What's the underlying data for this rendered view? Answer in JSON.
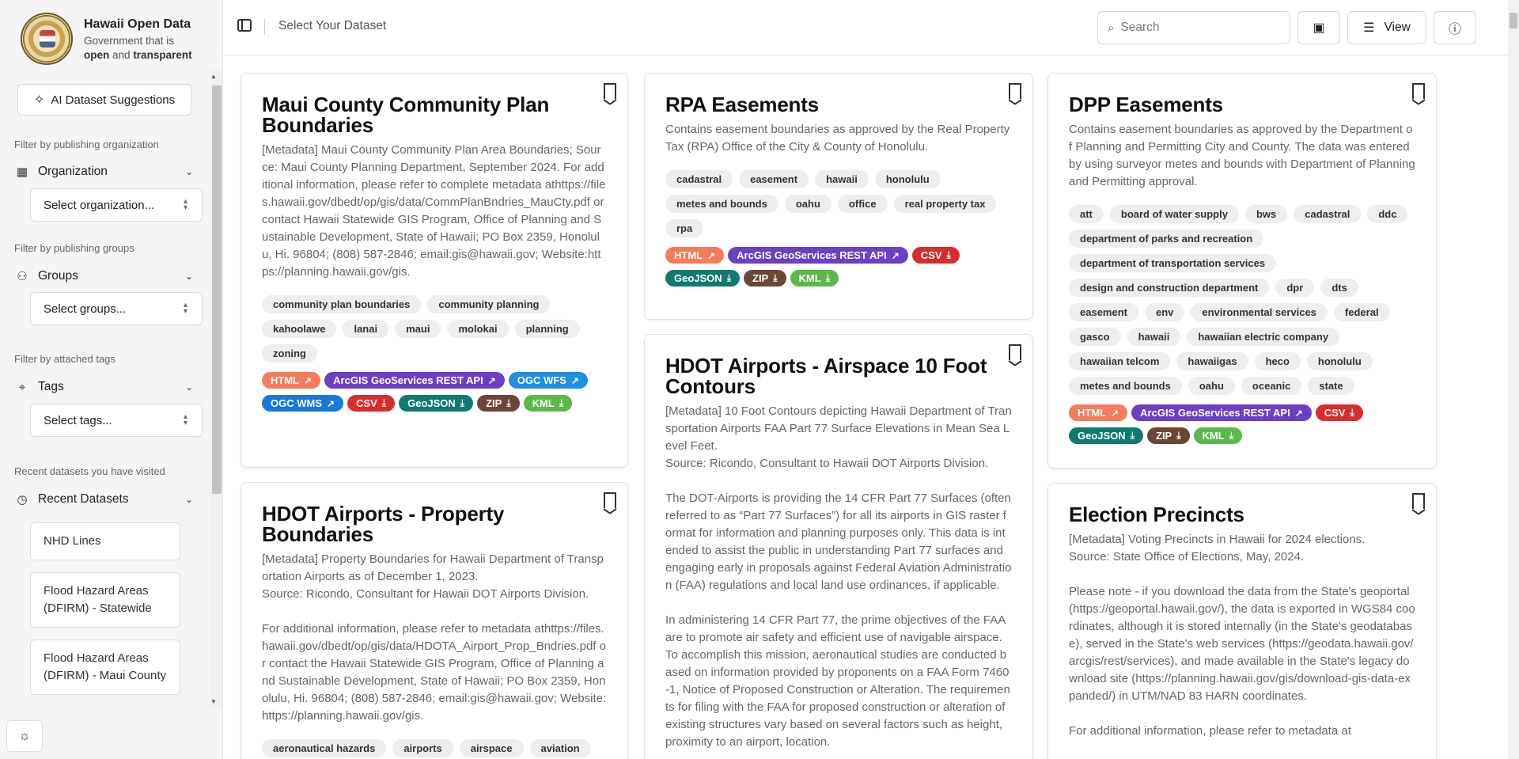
{
  "brand": {
    "title": "Hawaii Open Data",
    "subtitle_pre": "Government that is",
    "subtitle_open": "open",
    "subtitle_and": "and",
    "subtitle_transparent": "transparent"
  },
  "sidebar": {
    "ai_button": "AI Dataset Suggestions",
    "org": {
      "hint": "Filter by publishing organization",
      "label": "Organization",
      "placeholder": "Select organization..."
    },
    "groups": {
      "hint": "Filter by publishing groups",
      "label": "Groups",
      "placeholder": "Select groups..."
    },
    "tags": {
      "hint": "Filter by attached tags",
      "label": "Tags",
      "placeholder": "Select tags..."
    },
    "recent": {
      "hint": "Recent datasets you have visited",
      "label": "Recent Datasets",
      "items": [
        "NHD Lines",
        "Flood Hazard Areas (DFIRM) - Statewide",
        "Flood Hazard Areas (DFIRM) - Maui County"
      ]
    }
  },
  "header": {
    "breadcrumb": "Select Your Dataset",
    "search_placeholder": "Search",
    "view_label": "View"
  },
  "icons": {
    "seal": "state-seal",
    "ai": "sparkle-brain-icon",
    "org": "building-icon",
    "groups": "users-icon",
    "tags": "tags-icon",
    "recent": "clock-icon",
    "theme": "sun-icon",
    "search": "search-icon",
    "calendar": "calendar-icon",
    "view": "sliders-icon",
    "help": "help-circle-icon",
    "bookmark": "bookmark-icon"
  },
  "format_colors": {
    "HTML": "#f47c5a",
    "ArcGIS GeoServices REST API": "#6c3fc4",
    "OGC WFS": "#1f8fe0",
    "OGC WMS": "#1a78d8",
    "CSV": "#d92d2d",
    "GeoJSON": "#0f7a70",
    "ZIP": "#6b4535",
    "KML": "#5cb84a"
  },
  "cards": [
    {
      "title": "Maui County Community Plan Boundaries",
      "description": "[Metadata] Maui County Community Plan Area Boundaries; Source: Maui County Planning Department, September 2024. For additional information, please refer to complete metadata athttps://files.hawaii.gov/dbedt/op/gis/data/CommPlanBndries_MauCty.pdf or contact Hawaii Statewide GIS Program, Office of Planning and Sustainable Development, State of Hawaii; PO Box 2359, Honolulu, Hi. 96804; (808) 587-2846; email:gis@hawaii.gov; Website:https://planning.hawaii.gov/gis.",
      "tags": [
        "community plan boundaries",
        "community planning",
        "kahoolawe",
        "lanai",
        "maui",
        "molokai",
        "planning",
        "zoning"
      ],
      "formats": [
        {
          "label": "HTML",
          "icon": "external-link-icon"
        },
        {
          "label": "ArcGIS GeoServices REST API",
          "icon": "external-link-icon"
        },
        {
          "label": "OGC WFS",
          "icon": "external-link-icon"
        },
        {
          "label": "OGC WMS",
          "icon": "external-link-icon"
        },
        {
          "label": "CSV",
          "icon": "download-icon"
        },
        {
          "label": "GeoJSON",
          "icon": "download-icon"
        },
        {
          "label": "ZIP",
          "icon": "download-icon"
        },
        {
          "label": "KML",
          "icon": "download-icon"
        }
      ]
    },
    {
      "title": "HDOT Airports - Property Boundaries",
      "description": "[Metadata] Property Boundaries for Hawaii Department of Transportation Airports as of December 1, 2023.\nSource: Ricondo, Consultant for Hawaii DOT Airports Division.\n\nFor additional information, please refer to metadata athttps://files.hawaii.gov/dbedt/op/gis/data/HDOTA_Airport_Prop_Bndries.pdf or contact the Hawaii Statewide GIS Program, Office of Planning and Sustainable Development, State of Hawaii; PO Box 2359, Honolulu, Hi. 96804; (808) 587-2846; email:gis@hawaii.gov; Website:https://planning.hawaii.gov/gis.",
      "tags": [
        "aeronautical hazards",
        "airports",
        "airspace",
        "aviation"
      ],
      "formats": []
    },
    {
      "title": "RPA Easements",
      "description": "Contains easement boundaries as approved by the Real Property Tax (RPA) Office of the City & County of Honolulu.",
      "tags": [
        "cadastral",
        "easement",
        "hawaii",
        "honolulu",
        "metes and bounds",
        "oahu",
        "office",
        "real property tax",
        "rpa"
      ],
      "formats": [
        {
          "label": "HTML",
          "icon": "external-link-icon"
        },
        {
          "label": "ArcGIS GeoServices REST API",
          "icon": "external-link-icon"
        },
        {
          "label": "CSV",
          "icon": "download-icon"
        },
        {
          "label": "GeoJSON",
          "icon": "download-icon"
        },
        {
          "label": "ZIP",
          "icon": "download-icon"
        },
        {
          "label": "KML",
          "icon": "download-icon"
        }
      ]
    },
    {
      "title": "HDOT Airports - Airspace 10 Foot Contours",
      "description": "[Metadata] 10 Foot Contours depicting Hawaii Department of Transportation Airports FAA Part 77 Surface Elevations in Mean Sea Level Feet.\nSource: Ricondo, Consultant to Hawaii DOT Airports Division.\n\nThe DOT-Airports is providing the 14 CFR Part 77 Surfaces (often referred to as “Part 77 Surfaces”) for all its airports in GIS raster format for information and planning purposes only. This data is intended to assist the public in understanding Part 77 surfaces and engaging early in proposals against Federal Aviation Administration (FAA) regulations and local land use ordinances, if applicable.\n\nIn administering 14 CFR Part 77, the prime objectives of the FAA are to promote air safety and efficient use of navigable airspace. To accomplish this mission, aeronautical studies are conducted based on information provided by proponents on a FAA Form 7460-1, Notice of Proposed Construction or Alteration. The requirements for filing with the FAA for proposed construction or alteration of existing structures vary based on several factors such as height, proximity to an airport, location.",
      "tags": [],
      "formats": []
    },
    {
      "title": "DPP Easements",
      "description": "Contains easement boundaries as approved by the Department of Planning and Permitting City and County. The data was entered by using surveyor metes and bounds with Department of Planning and Permitting approval.",
      "tags": [
        "att",
        "board of water supply",
        "bws",
        "cadastral",
        "ddc",
        "department of parks and recreation",
        "department of transportation services",
        "design and construction department",
        "dpr",
        "dts",
        "easement",
        "env",
        "environmental services",
        "federal",
        "gasco",
        "hawaii",
        "hawaiian electric company",
        "hawaiian telcom",
        "hawaiigas",
        "heco",
        "honolulu",
        "metes and bounds",
        "oahu",
        "oceanic",
        "state"
      ],
      "formats": [
        {
          "label": "HTML",
          "icon": "external-link-icon"
        },
        {
          "label": "ArcGIS GeoServices REST API",
          "icon": "external-link-icon"
        },
        {
          "label": "CSV",
          "icon": "download-icon"
        },
        {
          "label": "GeoJSON",
          "icon": "download-icon"
        },
        {
          "label": "ZIP",
          "icon": "download-icon"
        },
        {
          "label": "KML",
          "icon": "download-icon"
        }
      ]
    },
    {
      "title": "Election Precincts",
      "description": "[Metadata] Voting Precincts in Hawaii for 2024 elections.\nSource: State Office of Elections, May, 2024.\n\nPlease note - if you download the data from the State's geoportal (https://geoportal.hawaii.gov/), the data is exported in WGS84 coordinates, although it is stored internally (in the State's geodatabase), served in the State's web services (https://geodata.hawaii.gov/arcgis/rest/services), and made available in the State's legacy download site (https://planning.hawaii.gov/gis/download-gis-data-expanded/) in UTM/NAD 83 HARN coordinates.\n\nFor additional information, please refer to metadata at",
      "tags": [],
      "formats": []
    }
  ]
}
